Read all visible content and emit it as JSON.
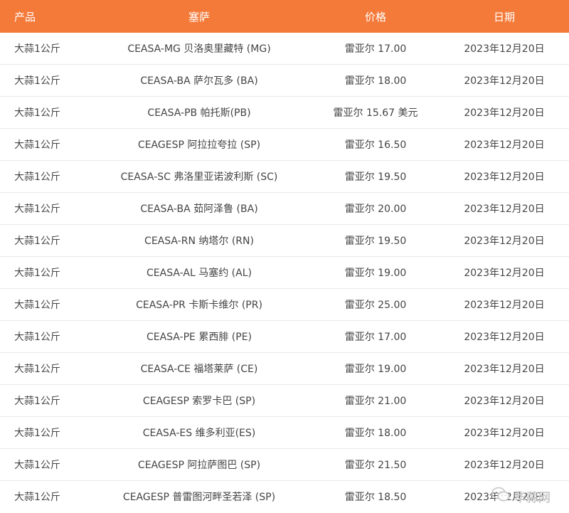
{
  "table": {
    "headers": [
      "产品",
      "塞萨",
      "价格",
      "日期"
    ],
    "rows": [
      {
        "product": "大蒜1公斤",
        "ceasa": "CEASA-MG 贝洛奥里藏特 (MG)",
        "price": "雷亚尔 17.00",
        "date": "2023年12月20日"
      },
      {
        "product": "大蒜1公斤",
        "ceasa": "CEASA-BA 萨尔瓦多 (BA)",
        "price": "雷亚尔 18.00",
        "date": "2023年12月20日"
      },
      {
        "product": "大蒜1公斤",
        "ceasa": "CEASA-PB 帕托斯(PB)",
        "price": "雷亚尔 15.67 美元",
        "date": "2023年12月20日"
      },
      {
        "product": "大蒜1公斤",
        "ceasa": "CEAGESP 阿拉拉夸拉 (SP)",
        "price": "雷亚尔 16.50",
        "date": "2023年12月20日"
      },
      {
        "product": "大蒜1公斤",
        "ceasa": "CEASA-SC 弗洛里亚诺波利斯 (SC)",
        "price": "雷亚尔 19.50",
        "date": "2023年12月20日"
      },
      {
        "product": "大蒜1公斤",
        "ceasa": "CEASA-BA 茹阿泽鲁 (BA)",
        "price": "雷亚尔 20.00",
        "date": "2023年12月20日"
      },
      {
        "product": "大蒜1公斤",
        "ceasa": "CEASA-RN 纳塔尔 (RN)",
        "price": "雷亚尔 19.50",
        "date": "2023年12月20日"
      },
      {
        "product": "大蒜1公斤",
        "ceasa": "CEASA-AL 马塞约 (AL)",
        "price": "雷亚尔 19.00",
        "date": "2023年12月20日"
      },
      {
        "product": "大蒜1公斤",
        "ceasa": "CEASA-PR 卡斯卡维尔 (PR)",
        "price": "雷亚尔 25.00",
        "date": "2023年12月20日"
      },
      {
        "product": "大蒜1公斤",
        "ceasa": "CEASA-PE 累西腓 (PE)",
        "price": "雷亚尔 17.00",
        "date": "2023年12月20日"
      },
      {
        "product": "大蒜1公斤",
        "ceasa": "CEASA-CE 福塔莱萨 (CE)",
        "price": "雷亚尔 19.00",
        "date": "2023年12月20日"
      },
      {
        "product": "大蒜1公斤",
        "ceasa": "CEAGESP 索罗卡巴 (SP)",
        "price": "雷亚尔 21.00",
        "date": "2023年12月20日"
      },
      {
        "product": "大蒜1公斤",
        "ceasa": "CEASA-ES 维多利亚(ES)",
        "price": "雷亚尔 18.00",
        "date": "2023年12月20日"
      },
      {
        "product": "大蒜1公斤",
        "ceasa": "CEAGESP 阿拉萨图巴 (SP)",
        "price": "雷亚尔 21.50",
        "date": "2023年12月20日"
      },
      {
        "product": "大蒜1公斤",
        "ceasa": "CEAGESP 普雷图河畔圣若泽 (SP)",
        "price": "雷亚尔 18.50",
        "date": "2023年12月20日"
      }
    ]
  },
  "watermark": {
    "text": "华蒜网",
    "icon": "wechat-icon"
  },
  "colors": {
    "header_bg": "#f47a3a",
    "header_text": "#ffffff",
    "row_divider": "#e8e8e8",
    "body_text": "#444444"
  }
}
